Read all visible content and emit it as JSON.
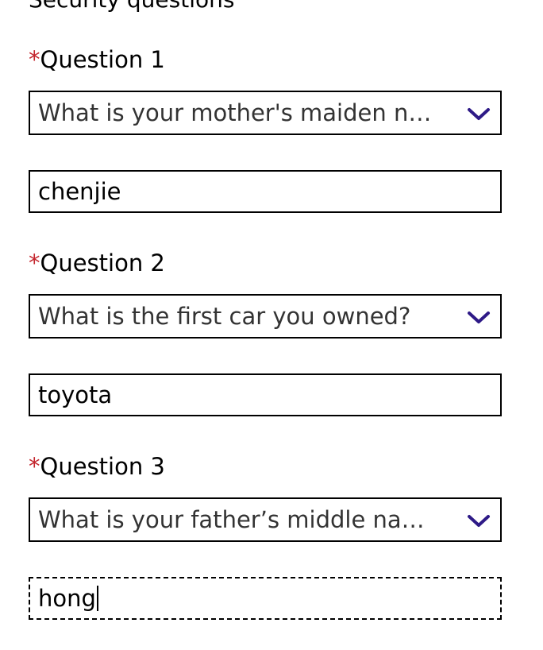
{
  "section": {
    "title": "Security questions"
  },
  "required_marker": "*",
  "accent_color": "#2e1a87",
  "required_color": "#c4262e",
  "questions": [
    {
      "label": "Question 1",
      "selected_question": "What is your mother's maiden n…",
      "answer": "chenjie",
      "icon": "chevron-down-icon"
    },
    {
      "label": "Question 2",
      "selected_question": "What is the first car you owned?",
      "answer": "toyota",
      "icon": "chevron-down-icon"
    },
    {
      "label": "Question 3",
      "selected_question": "What is your father’s middle na…",
      "answer": "hong",
      "icon": "chevron-down-icon"
    }
  ]
}
